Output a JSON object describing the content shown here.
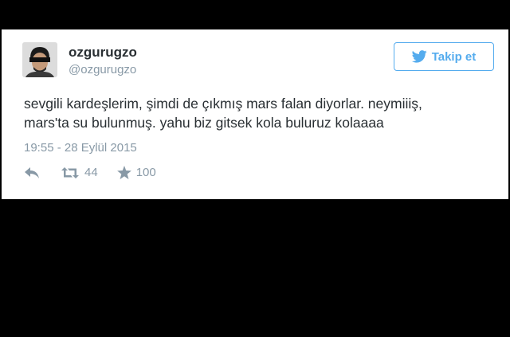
{
  "tweet": {
    "display_name": "ozgurugzo",
    "handle": "@ozgurugzo",
    "text_line1": "sevgili kardeşlerim, şimdi de çıkmış mars falan diyorlar. neymiiiş,",
    "text_line2": "mars'ta su bulunmuş. yahu biz gitsek kola buluruz kolaaaa",
    "timestamp": "19:55 - 28 Eylül 2015",
    "retweet_count": "44",
    "like_count": "100"
  },
  "follow_button": {
    "label": "Takip et"
  },
  "icons": {
    "avatar": "avatar-image",
    "follow": "twitter-bird-icon",
    "reply": "reply-icon",
    "retweet": "retweet-icon",
    "like": "star-icon"
  },
  "colors": {
    "accent": "#55acee",
    "text": "#292f33",
    "muted": "#8899a6",
    "card": "#ffffff",
    "backdrop": "#000000"
  }
}
